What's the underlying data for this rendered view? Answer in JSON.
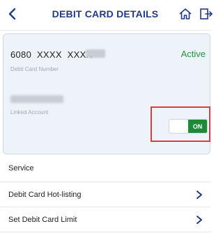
{
  "header": {
    "title": "DEBIT CARD DETAILS",
    "back_icon": "chevron-left-icon",
    "home_icon": "home-icon",
    "logout_icon": "logout-icon"
  },
  "card": {
    "number_visible": "6080  XXXX  XXXX",
    "status": "Active",
    "number_label": "Debit Card Number",
    "linked_label": "Linked Account",
    "status_color": "#1a9a3e"
  },
  "toggle": {
    "state_label": "ON",
    "on_color": "#1d8a35"
  },
  "service": {
    "title": "Service",
    "items": [
      {
        "label": "Debit Card Hot-listing"
      },
      {
        "label": "Set Debit Card Limit"
      }
    ]
  },
  "colors": {
    "brand": "#1f3b87",
    "highlight": "#e13a3a"
  }
}
